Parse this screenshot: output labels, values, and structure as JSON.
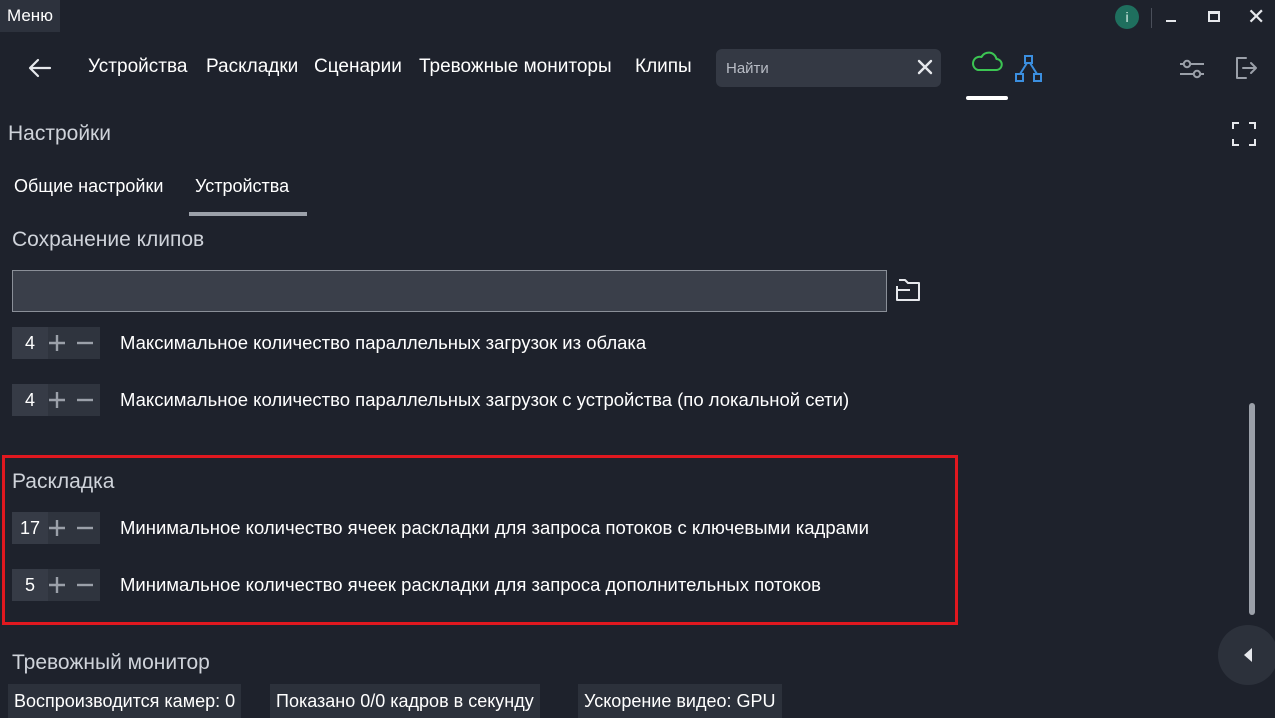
{
  "titlebar": {
    "menu_label": "Меню",
    "info_label": "i"
  },
  "nav": {
    "links": [
      "Устройства",
      "Раскладки",
      "Сценарии",
      "Тревожные мониторы",
      "Клипы"
    ],
    "search_placeholder": "Найти",
    "search_value": ""
  },
  "page": {
    "title": "Настройки",
    "tabs": [
      "Общие настройки",
      "Устройства"
    ],
    "active_tab": "Устройства"
  },
  "clips": {
    "title": "Сохранение клипов",
    "path_value": "",
    "rows": [
      {
        "value": "4",
        "label": "Максимальное количество параллельных загрузок из облака"
      },
      {
        "value": "4",
        "label": "Максимальное количество параллельных загрузок с устройства (по локальной сети)"
      }
    ]
  },
  "layout_section": {
    "title": "Раскладка",
    "rows": [
      {
        "value": "17",
        "label": "Минимальное количество ячеек раскладки для запроса потоков с ключевыми кадрами"
      },
      {
        "value": "5",
        "label": "Минимальное количество ячеек раскладки для запроса дополнительных потоков"
      }
    ]
  },
  "alarm": {
    "title": "Тревожный монитор"
  },
  "status": {
    "items": [
      "Воспроизводится камер: 0",
      "Показано 0/0 кадров в секунду",
      "Ускорение видео: GPU"
    ]
  },
  "colors": {
    "background": "#1e222c",
    "cloud_icon": "#3cc553",
    "network_icon": "#3b8fe0",
    "highlight": "#e0181f",
    "info_badge": "#1f6f5e"
  }
}
